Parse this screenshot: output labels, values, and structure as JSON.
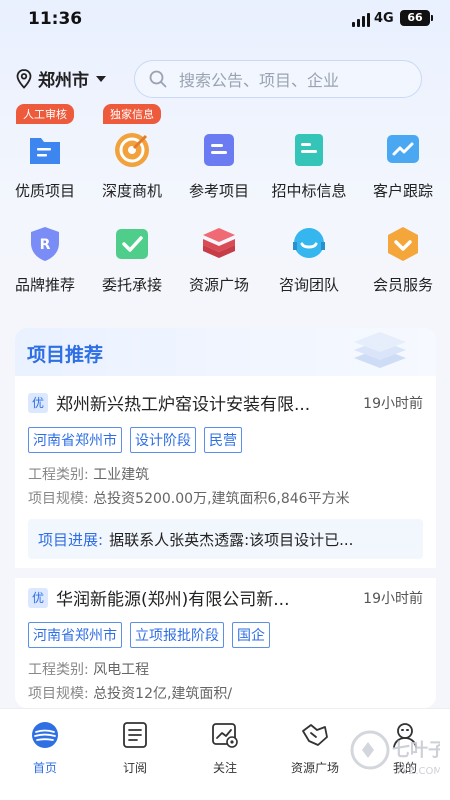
{
  "status": {
    "time": "11:36",
    "network": "4G",
    "battery": "66"
  },
  "header": {
    "city": "郑州市",
    "search_placeholder": "搜索公告、项目、企业"
  },
  "grid": [
    {
      "label": "优质项目",
      "tag": "人工审核",
      "icon": "document-folder-icon"
    },
    {
      "label": "深度商机",
      "tag": "独家信息",
      "icon": "target-icon"
    },
    {
      "label": "参考项目",
      "tag": "",
      "icon": "notes-icon"
    },
    {
      "label": "招中标信息",
      "tag": "",
      "icon": "bid-document-icon"
    },
    {
      "label": "客户跟踪",
      "tag": "",
      "icon": "trend-chart-icon"
    },
    {
      "label": "品牌推荐",
      "tag": "",
      "icon": "brand-shield-icon"
    },
    {
      "label": "委托承接",
      "tag": "",
      "icon": "check-handshake-icon"
    },
    {
      "label": "资源广场",
      "tag": "",
      "icon": "layers-icon"
    },
    {
      "label": "咨询团队",
      "tag": "",
      "icon": "consult-smile-icon"
    },
    {
      "label": "会员服务",
      "tag": "",
      "icon": "vip-badge-icon"
    }
  ],
  "recommend": {
    "title": "项目推荐",
    "items": [
      {
        "badge": "优",
        "name": "郑州新兴热工炉窑设计安装有限...",
        "time": "19小时前",
        "tags": [
          "河南省郑州市",
          "设计阶段",
          "民营"
        ],
        "category_label": "工程类别:",
        "category": "工业建筑",
        "scale_label": "项目规模:",
        "scale": "总投资5200.00万,建筑面积6,846平方米",
        "progress_label": "项目进展:",
        "progress": "据联系人张英杰透露:该项目设计已..."
      },
      {
        "badge": "优",
        "name": "华润新能源(郑州)有限公司新...",
        "time": "19小时前",
        "tags": [
          "河南省郑州市",
          "立项报批阶段",
          "国企"
        ],
        "category_label": "工程类别:",
        "category": "风电工程",
        "scale_label": "项目规模:",
        "scale": "总投资12亿,建筑面积/"
      }
    ]
  },
  "tabs": [
    {
      "label": "首页",
      "icon": "home-globe-icon",
      "active": true
    },
    {
      "label": "订阅",
      "icon": "list-icon",
      "active": false
    },
    {
      "label": "关注",
      "icon": "follow-chart-icon",
      "active": false
    },
    {
      "label": "资源广场",
      "icon": "handshake-icon",
      "active": false
    },
    {
      "label": "我的",
      "icon": "profile-icon",
      "active": false
    }
  ],
  "watermark": "七叶子 7YZ.COM",
  "colors": {
    "primary": "#2f6fe4",
    "tag_red": "#ee5b3c",
    "page_bg": "#f4f6fb"
  }
}
